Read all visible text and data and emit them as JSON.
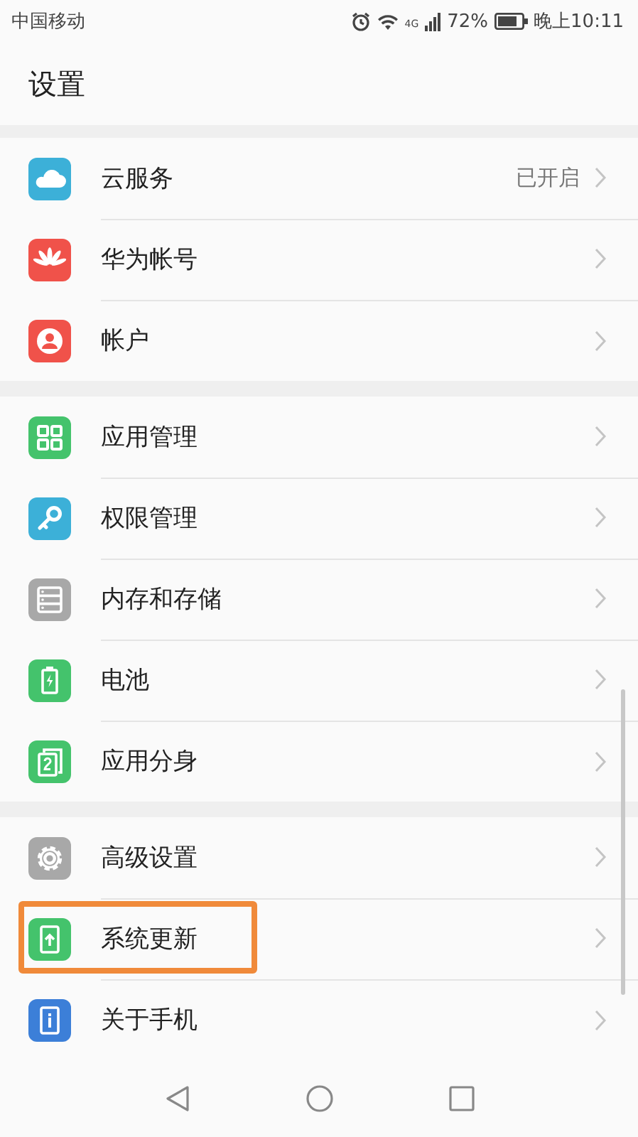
{
  "status_bar": {
    "carrier": "中国移动",
    "network": "4G",
    "battery_text": "72%",
    "time": "晚上10:11"
  },
  "title": "设置",
  "groups": [
    {
      "items": [
        {
          "label": "云服务",
          "kind": "cloud",
          "value": "已开启",
          "highlighted": false
        },
        {
          "label": "华为帐号",
          "kind": "petals",
          "highlighted": false
        },
        {
          "label": "帐户",
          "kind": "person",
          "highlighted": false
        }
      ]
    },
    {
      "items": [
        {
          "label": "应用管理",
          "kind": "grid",
          "highlighted": false
        },
        {
          "label": "权限管理",
          "kind": "key",
          "highlighted": false
        },
        {
          "label": "内存和存储",
          "kind": "storage",
          "highlighted": false
        },
        {
          "label": "电池",
          "kind": "battery",
          "highlighted": false
        },
        {
          "label": "应用分身",
          "kind": "twin",
          "highlighted": false
        }
      ]
    },
    {
      "items": [
        {
          "label": "高级设置",
          "kind": "gear",
          "highlighted": false
        },
        {
          "label": "系统更新",
          "kind": "update",
          "highlighted": true
        },
        {
          "label": "关于手机",
          "kind": "info",
          "highlighted": false
        }
      ]
    }
  ]
}
